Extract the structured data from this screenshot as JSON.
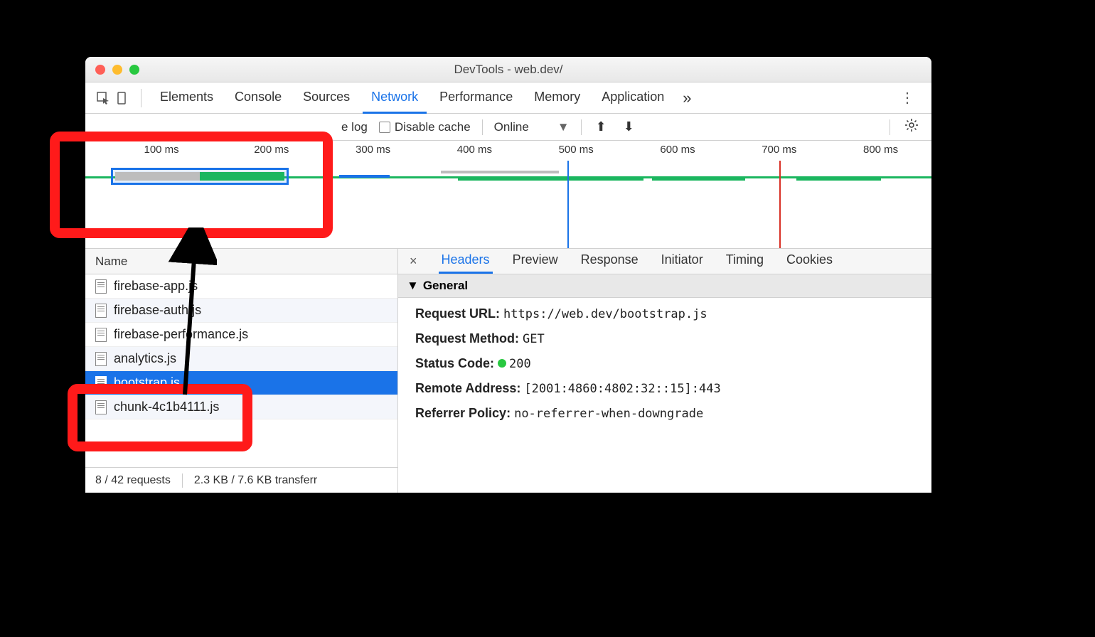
{
  "window": {
    "title": "DevTools - web.dev/"
  },
  "tabs": [
    "Elements",
    "Console",
    "Sources",
    "Network",
    "Performance",
    "Memory",
    "Application"
  ],
  "active_tab": "Network",
  "toolbar": {
    "preserve_log_label": "e log",
    "disable_cache_label": "Disable cache",
    "online_label": "Online"
  },
  "overview": {
    "ticks": [
      "100 ms",
      "200 ms",
      "300 ms",
      "400 ms",
      "500 ms",
      "600 ms",
      "700 ms",
      "800 ms"
    ]
  },
  "name_column": "Name",
  "requests": [
    "firebase-app.js",
    "firebase-auth.js",
    "firebase-performance.js",
    "analytics.js",
    "bootstrap.js",
    "chunk-4c1b4111.js"
  ],
  "selected_request": "bootstrap.js",
  "status_bar": {
    "requests": "8 / 42 requests",
    "transfer": "2.3 KB / 7.6 KB transferr"
  },
  "detail_tabs": [
    "Headers",
    "Preview",
    "Response",
    "Initiator",
    "Timing",
    "Cookies"
  ],
  "active_detail_tab": "Headers",
  "general_section": "General",
  "general": {
    "request_url_label": "Request URL:",
    "request_url": "https://web.dev/bootstrap.js",
    "method_label": "Request Method:",
    "method": "GET",
    "status_label": "Status Code:",
    "status": "200",
    "remote_label": "Remote Address:",
    "remote": "[2001:4860:4802:32::15]:443",
    "referrer_label": "Referrer Policy:",
    "referrer": "no-referrer-when-downgrade"
  }
}
